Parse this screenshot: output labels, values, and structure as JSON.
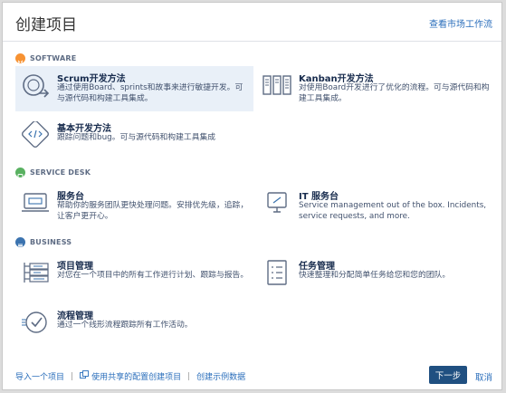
{
  "dialog": {
    "title": "创建项目",
    "marketplace_link": "查看市场工作流"
  },
  "sections": [
    {
      "label": "SOFTWARE",
      "items": [
        {
          "name": "Scrum开发方法",
          "desc": "通过使用Board、sprints和故事来进行敏捷开发。可与源代码和构建工具集成。",
          "icon": "scrum-icon",
          "selected": true
        },
        {
          "name": "Kanban开发方法",
          "desc": "对使用Board开发进行了优化的流程。可与源代码和构建工具集成。",
          "icon": "kanban-icon"
        },
        {
          "name": "基本开发方法",
          "desc": "跟踪问题和bug。可与源代码和构建工具集成",
          "icon": "code-icon"
        }
      ]
    },
    {
      "label": "SERVICE DESK",
      "items": [
        {
          "name": "服务台",
          "desc": "帮助你的服务团队更快处理问题。安排优先级，追踪，让客户更开心。",
          "icon": "service-desk-icon"
        },
        {
          "name": "IT 服务台",
          "desc": "Service management out of the box. Incidents, service requests, and more.",
          "icon": "it-service-icon"
        }
      ]
    },
    {
      "label": "BUSINESS",
      "items": [
        {
          "name": "项目管理",
          "desc": "对您在一个项目中的所有工作进行计划、跟踪与报告。",
          "icon": "project-management-icon"
        },
        {
          "name": "任务管理",
          "desc": "快速整理和分配简单任务给您和您的团队。",
          "icon": "task-management-icon"
        },
        {
          "name": "流程管理",
          "desc": "通过一个线形流程跟踪所有工作活动。",
          "icon": "process-management-icon"
        }
      ]
    }
  ],
  "footer": {
    "import_project": "导入一个项目",
    "shared_config": "使用共享的配置创建项目",
    "sample_data": "创建示例数据",
    "next_button": "下一步",
    "cancel": "取消"
  },
  "colors": {
    "software": "#f79232",
    "service_desk": "#59b161",
    "business": "#3b73af",
    "primary_button": "#205081",
    "link": "#2a6ebb"
  }
}
